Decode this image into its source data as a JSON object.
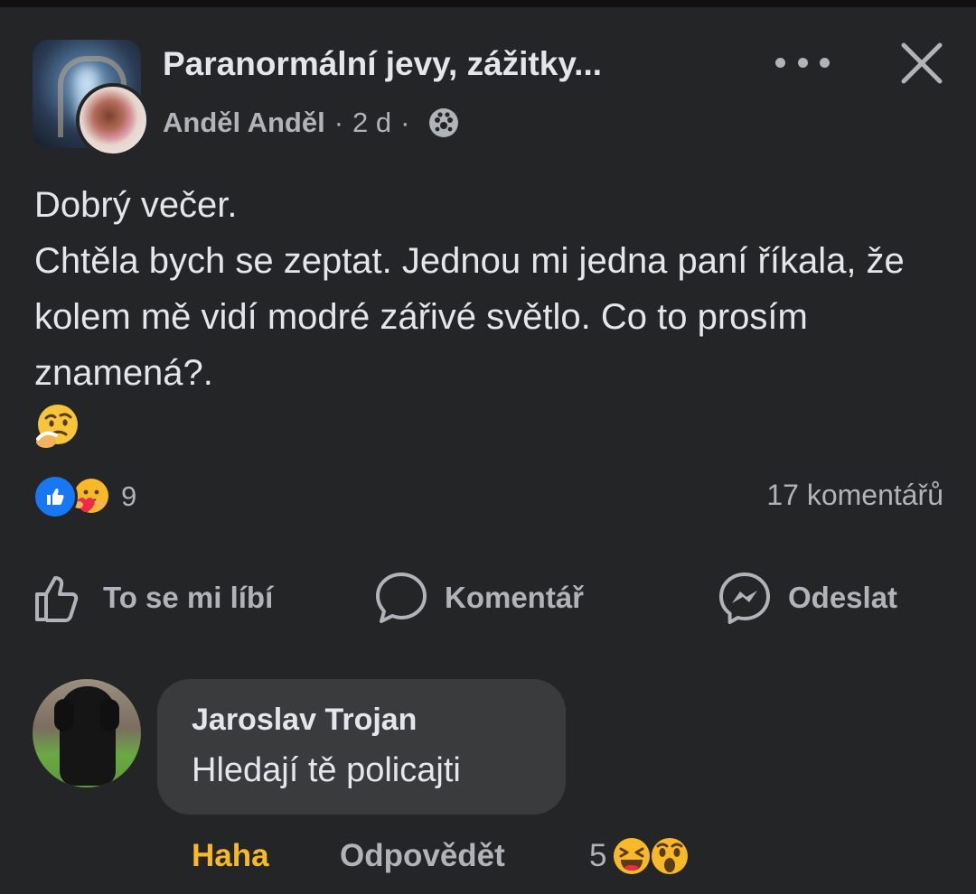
{
  "header": {
    "group_name": "Paranormální jevy, zážitky...",
    "author": "Anděl Anděl",
    "separator": "·",
    "time": "2 d",
    "audience_icon": "group-audience-icon",
    "more_icon": "more-dots-icon",
    "close_icon": "close-icon"
  },
  "post": {
    "lines": [
      "Dobrý večer.",
      "Chtěla bych se zeptat. Jednou mi jedna paní říkala, že kolem mě vidí modré zářivé světlo. Co to prosím znamená?."
    ],
    "emoji": "thinking-face-icon"
  },
  "stats": {
    "reactions": [
      "like-reaction-icon",
      "care-reaction-icon"
    ],
    "reaction_count": "9",
    "comment_count": "17 komentářů"
  },
  "actions": {
    "like": "To se mi líbí",
    "comment": "Komentář",
    "share": "Odeslat"
  },
  "comment": {
    "author": "Jaroslav Trojan",
    "text": "Hledají tě policajti",
    "reaction_label": "Haha",
    "reply_label": "Odpovědět",
    "reaction_count": "5",
    "reaction_icons": [
      "haha-reaction-icon",
      "wow-reaction-icon"
    ]
  },
  "colors": {
    "background": "#242526",
    "bubble": "#3a3b3c",
    "text_primary": "#e4e6eb",
    "text_secondary": "#b0b3b8",
    "haha_accent": "#f7b928",
    "like_blue": "#1877f2"
  }
}
